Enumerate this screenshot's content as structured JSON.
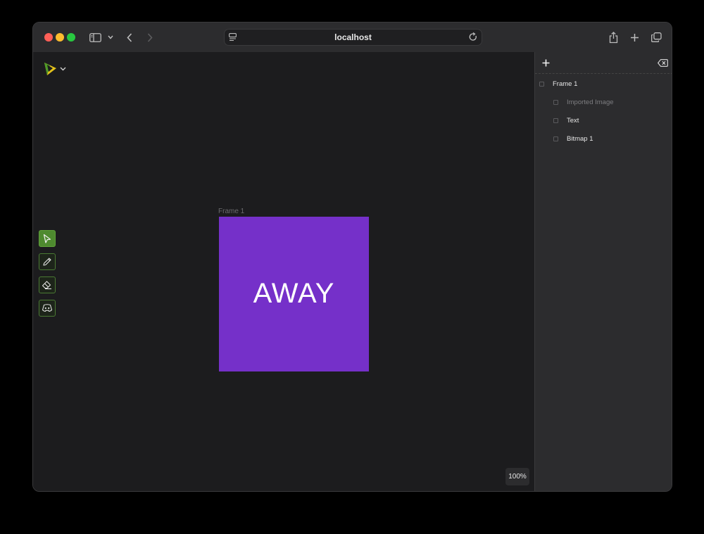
{
  "browser": {
    "url": "localhost",
    "icons": {
      "sidebar": "sidebar-icon",
      "back": "chevron-left-icon",
      "forward": "chevron-right-icon",
      "reload": "reload-icon",
      "share": "share-icon",
      "new_tab": "plus-icon",
      "tabs": "tabs-overview-icon"
    }
  },
  "canvas": {
    "frame_label": "Frame 1",
    "frame_text": "AWAY",
    "frame_color": "#7530c9",
    "zoom": "100%",
    "tools": [
      "select-tool",
      "pencil-tool",
      "eraser-tool",
      "discord-tool"
    ]
  },
  "layers_panel": {
    "add_icon": "plus-icon",
    "delete_icon": "delete-icon",
    "items": [
      {
        "label": "Frame 1",
        "level": 0,
        "dimmed": false
      },
      {
        "label": "Imported Image",
        "level": 1,
        "dimmed": true
      },
      {
        "label": "Text",
        "level": 1,
        "dimmed": false
      },
      {
        "label": "Bitmap 1",
        "level": 1,
        "dimmed": false
      }
    ]
  },
  "colors": {
    "accent_green": "#4e8a2f",
    "canvas_bg": "#1c1c1e",
    "panel_bg": "#2c2c2e"
  }
}
